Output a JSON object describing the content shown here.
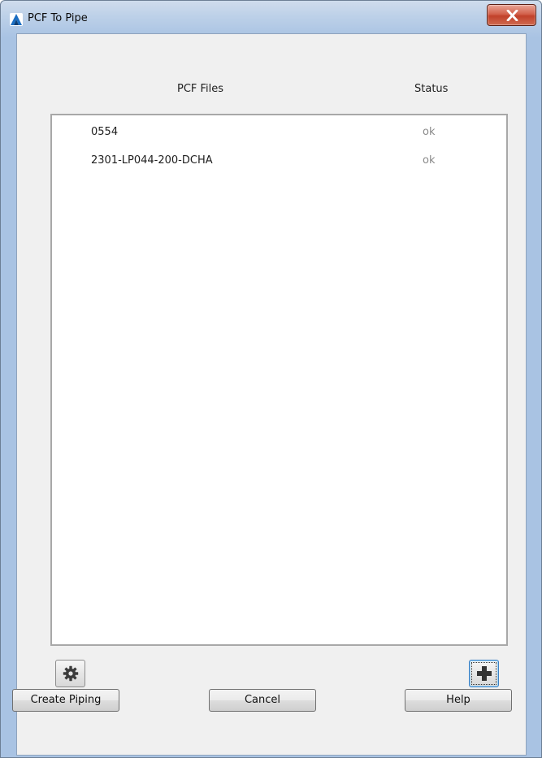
{
  "window": {
    "title": "PCF To Pipe",
    "close_icon": "close-x-icon",
    "app_icon": "autodesk-plant-icon"
  },
  "list": {
    "headers": {
      "files": "PCF Files",
      "status": "Status"
    },
    "rows": [
      {
        "file": "0554",
        "status": "ok"
      },
      {
        "file": "2301-LP044-200-DCHA",
        "status": "ok"
      }
    ]
  },
  "toolbar": {
    "settings_icon": "gear-icon",
    "add_icon": "plus-icon"
  },
  "buttons": {
    "create": "Create Piping",
    "cancel": "Cancel",
    "help": "Help"
  },
  "colors": {
    "titlebar": "#b9cfe8",
    "close_button": "#c7462f",
    "client": "#f0f0f0",
    "status_text": "#8a8a8a",
    "focus_border": "#3a7fc4"
  }
}
